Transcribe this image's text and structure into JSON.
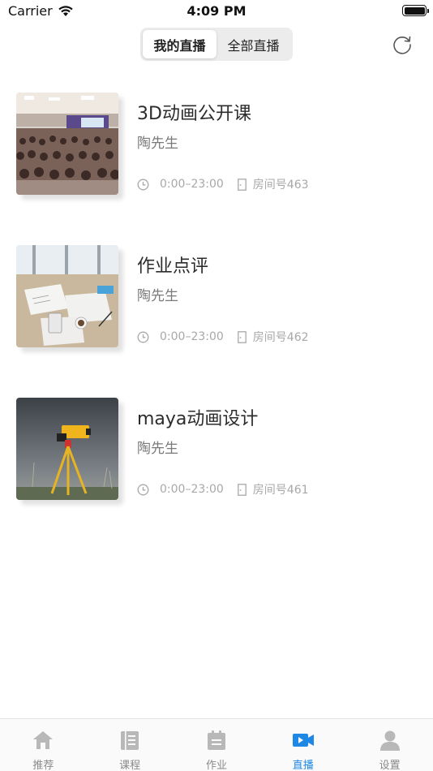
{
  "status_bar": {
    "carrier": "Carrier",
    "time": "4:09 PM"
  },
  "nav": {
    "segments": [
      {
        "label": "我的直播",
        "active": true
      },
      {
        "label": "全部直播",
        "active": false
      }
    ],
    "refresh_icon": "refresh-icon"
  },
  "live_list": [
    {
      "title": "3D动画公开课",
      "teacher": "陶先生",
      "time": "0:00–23:00",
      "room": "房间号463",
      "thumbnail": "conference-hall-photo"
    },
    {
      "title": "作业点评",
      "teacher": "陶先生",
      "time": "0:00–23:00",
      "room": "房间号462",
      "thumbnail": "desk-papers-photo"
    },
    {
      "title": "maya动画设计",
      "teacher": "陶先生",
      "time": "0:00–23:00",
      "room": "房间号461",
      "thumbnail": "surveying-tripod-photo"
    }
  ],
  "tab_bar": {
    "items": [
      {
        "label": "推荐",
        "icon": "home-icon",
        "active": false
      },
      {
        "label": "课程",
        "icon": "book-icon",
        "active": false
      },
      {
        "label": "作业",
        "icon": "clipboard-icon",
        "active": false
      },
      {
        "label": "直播",
        "icon": "video-icon",
        "active": true
      },
      {
        "label": "设置",
        "icon": "person-icon",
        "active": false
      }
    ]
  },
  "colors": {
    "accent": "#1e88e5",
    "inactive_icon": "#b8b8b8",
    "text_primary": "#2c2c2c",
    "text_secondary": "#7a7a7a",
    "text_meta": "#a8a8a8"
  }
}
